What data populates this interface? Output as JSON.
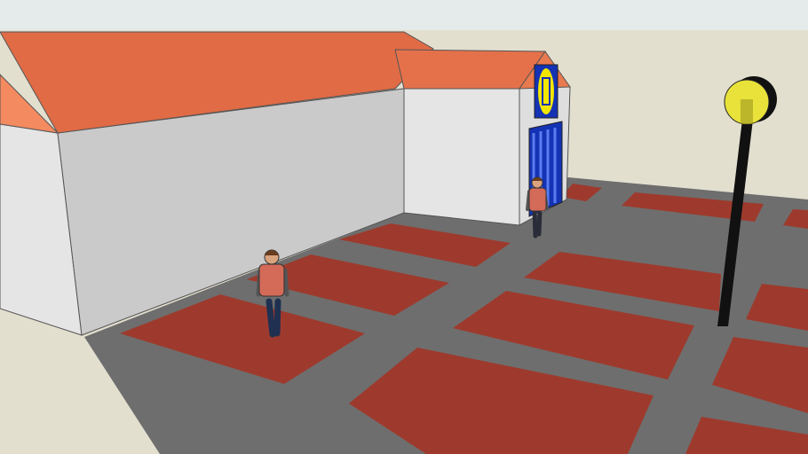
{
  "scene": {
    "type": "3d-model-render",
    "colors": {
      "sky": "#e4ebea",
      "ground": "#e3dfcf",
      "pavement": "#6e6e6e",
      "parking_tile": "#9e3a2d",
      "roof": "#e5714b",
      "roof_dark": "#d9643f",
      "wall_light": "#e5e5e5",
      "wall_shade": "#c8c8c8",
      "lidl_blue": "#1432b4",
      "lidl_yellow": "#f2e600",
      "lamp_pole": "#111111",
      "lamp_globe": "#e8e23a"
    },
    "people": [
      {
        "name": "person-near"
      },
      {
        "name": "person-far"
      }
    ],
    "logo_text": ""
  }
}
